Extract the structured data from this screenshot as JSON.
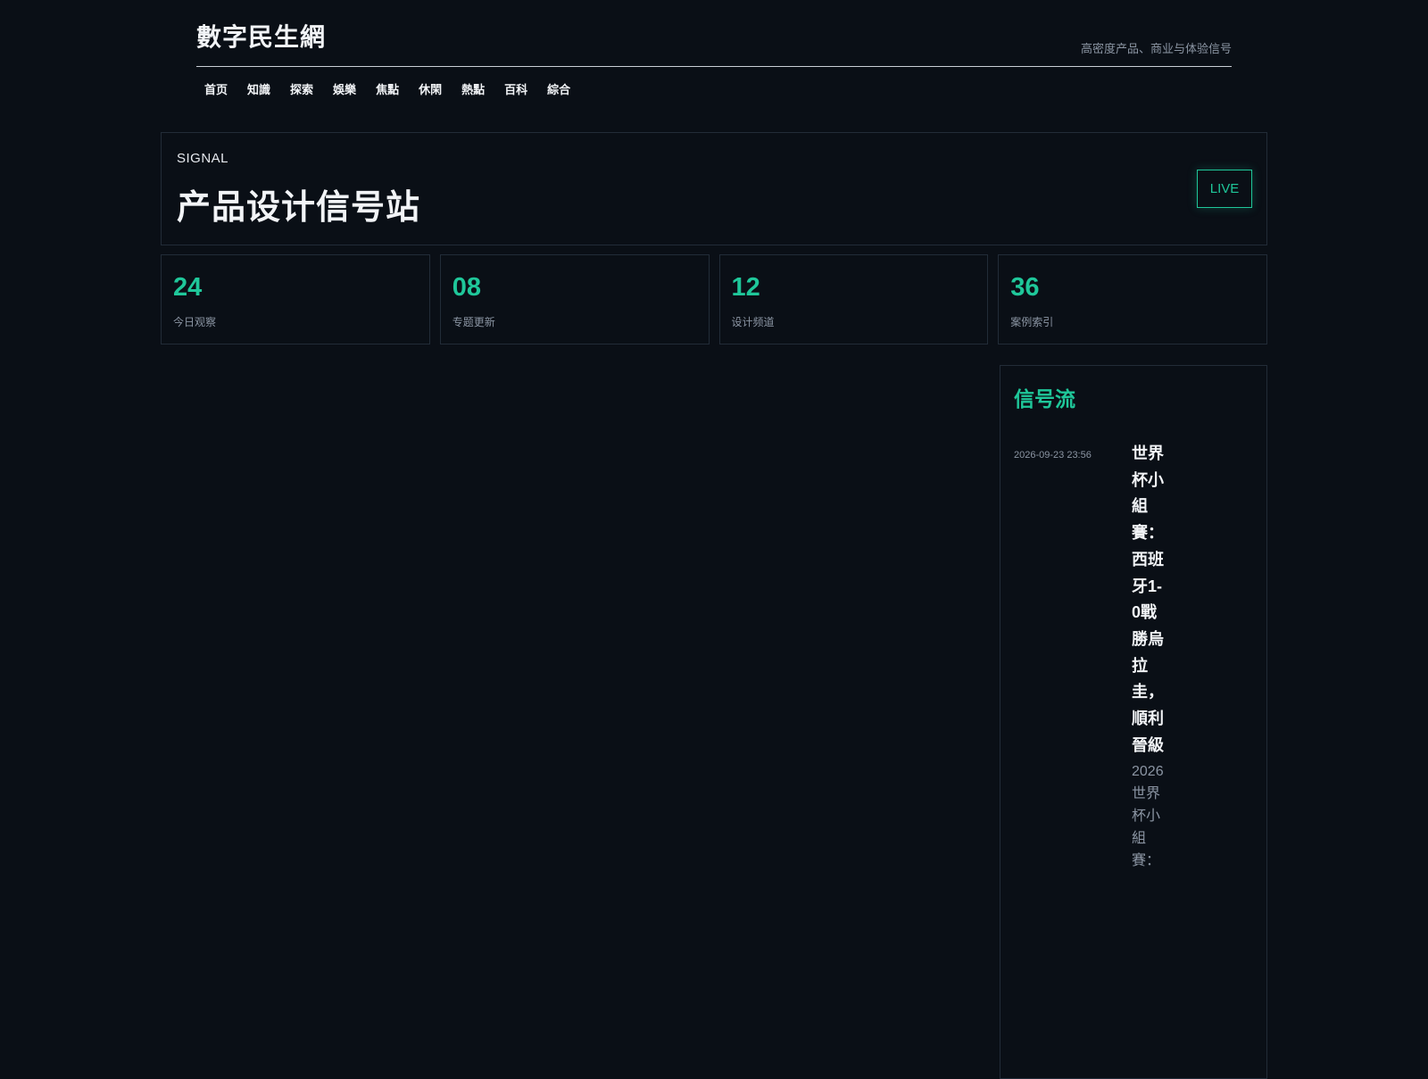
{
  "site": {
    "title": "數字民生網",
    "tagline": "高密度产品、商业与体验信号"
  },
  "nav": {
    "items": [
      "首页",
      "知識",
      "探索",
      "娛樂",
      "焦點",
      "休閑",
      "熱點",
      "百科",
      "綜合"
    ]
  },
  "hero": {
    "eyebrow": "SIGNAL",
    "title": "产品设计信号站",
    "badge": "LIVE"
  },
  "stats": [
    {
      "value": "24",
      "label": "今日观察"
    },
    {
      "value": "08",
      "label": "专题更新"
    },
    {
      "value": "12",
      "label": "设计频道"
    },
    {
      "value": "36",
      "label": "案例索引"
    }
  ],
  "sidebar": {
    "title": "信号流",
    "feed": [
      {
        "time": "2026-09-23 23:56",
        "headline": "世界杯小組賽：西班牙1-0戰勝烏拉圭，順利晉級",
        "summary": "2026世界杯小組賽："
      }
    ]
  },
  "colors": {
    "background": "#0a0f16",
    "accent": "#1fc79a",
    "border": "#222c38",
    "muted": "#8b95a3"
  }
}
